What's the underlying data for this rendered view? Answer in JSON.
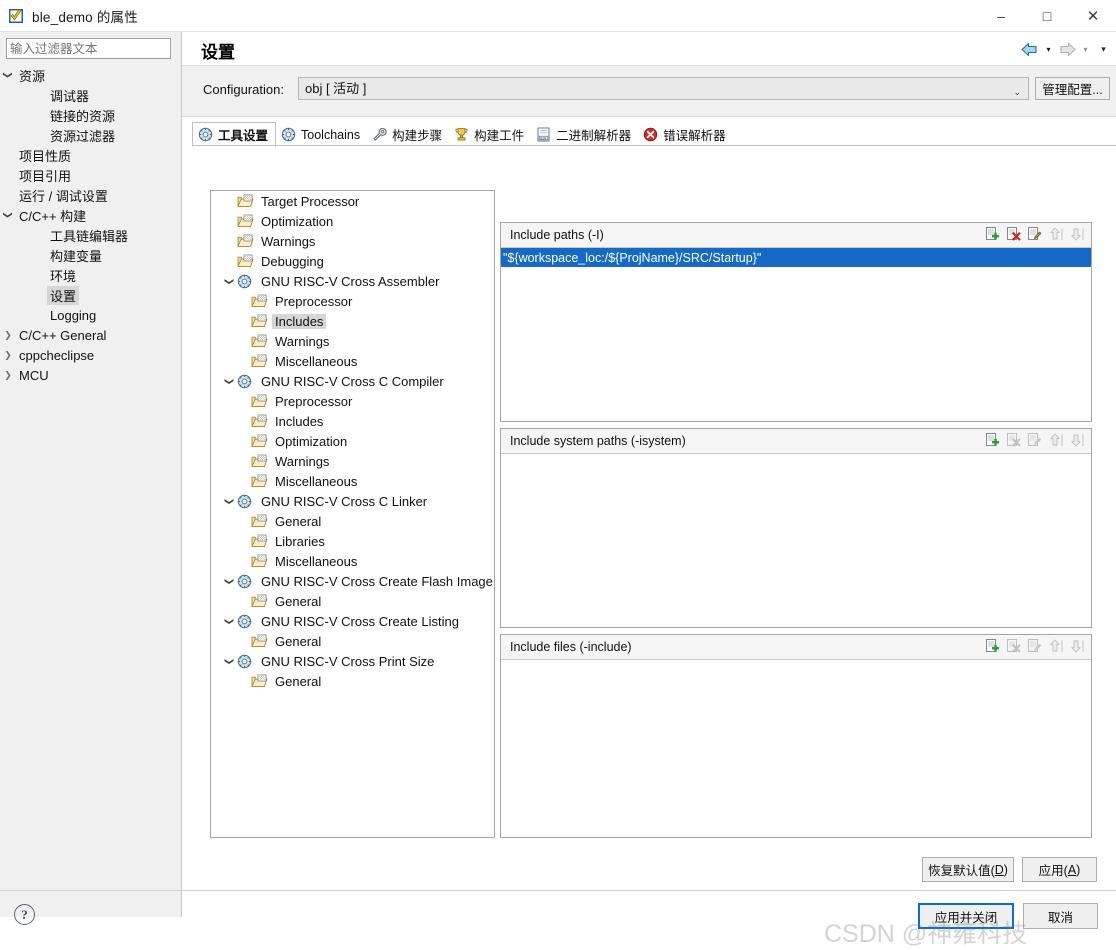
{
  "window": {
    "title": "ble_demo 的属性",
    "icon": "properties-icon",
    "minimize": "–",
    "maximize": "□",
    "close": "✕"
  },
  "sidebar": {
    "filter_placeholder": "输入过滤器文本",
    "filter_value": "",
    "items": [
      {
        "label": "资源",
        "level": 1,
        "twisty": "expanded"
      },
      {
        "label": "调试器",
        "level": 2,
        "twisty": "none"
      },
      {
        "label": "链接的资源",
        "level": 2,
        "twisty": "none"
      },
      {
        "label": "资源过滤器",
        "level": 2,
        "twisty": "none"
      },
      {
        "label": "项目性质",
        "level": 1,
        "twisty": "none"
      },
      {
        "label": "项目引用",
        "level": 1,
        "twisty": "none"
      },
      {
        "label": "运行 / 调试设置",
        "level": 1,
        "twisty": "none"
      },
      {
        "label": "C/C++ 构建",
        "level": 1,
        "twisty": "expanded"
      },
      {
        "label": "工具链编辑器",
        "level": 2,
        "twisty": "none"
      },
      {
        "label": "构建变量",
        "level": 2,
        "twisty": "none"
      },
      {
        "label": "环境",
        "level": 2,
        "twisty": "none"
      },
      {
        "label": "设置",
        "level": 2,
        "twisty": "none",
        "selected": true
      },
      {
        "label": "Logging",
        "level": 2,
        "twisty": "none"
      },
      {
        "label": "C/C++ General",
        "level": 1,
        "twisty": "collapsed"
      },
      {
        "label": "cppcheclipse",
        "level": 1,
        "twisty": "collapsed"
      },
      {
        "label": "MCU",
        "level": 1,
        "twisty": "collapsed"
      }
    ],
    "help_icon": "?"
  },
  "header": {
    "title": "设置",
    "nav_back_icon": "back-arrow-icon",
    "nav_back_chevron": "▾",
    "nav_forward_icon": "forward-arrow-icon",
    "nav_forward_chevron": "▾",
    "nav_menu_chevron": "▾"
  },
  "config": {
    "label": "Configuration:",
    "value": "obj [ 活动 ]",
    "dropdown_icon": "⌄",
    "manage_button": "管理配置..."
  },
  "tabs": [
    {
      "label": "工具设置",
      "icon": "gear-icon",
      "active": true
    },
    {
      "label": "Toolchains",
      "icon": "gear-icon",
      "active": false
    },
    {
      "label": "构建步骤",
      "icon": "wrench-icon",
      "active": false
    },
    {
      "label": "构建工件",
      "icon": "trophy-icon",
      "active": false
    },
    {
      "label": "二进制解析器",
      "icon": "binary-icon",
      "active": false
    },
    {
      "label": "错误解析器",
      "icon": "error-icon",
      "active": false
    }
  ],
  "tool_tree": [
    {
      "label": "Target Processor",
      "kind": "leaf",
      "indent": "top"
    },
    {
      "label": "Optimization",
      "kind": "leaf",
      "indent": "top"
    },
    {
      "label": "Warnings",
      "kind": "leaf",
      "indent": "top"
    },
    {
      "label": "Debugging",
      "kind": "leaf",
      "indent": "top"
    },
    {
      "label": "GNU RISC-V Cross Assembler",
      "kind": "group",
      "indent": "grp",
      "twisty": "expanded"
    },
    {
      "label": "Preprocessor",
      "kind": "leaf",
      "indent": "child"
    },
    {
      "label": "Includes",
      "kind": "leaf",
      "indent": "child",
      "selected": true
    },
    {
      "label": "Warnings",
      "kind": "leaf",
      "indent": "child"
    },
    {
      "label": "Miscellaneous",
      "kind": "leaf",
      "indent": "child"
    },
    {
      "label": "GNU RISC-V Cross C Compiler",
      "kind": "group",
      "indent": "grp",
      "twisty": "expanded"
    },
    {
      "label": "Preprocessor",
      "kind": "leaf",
      "indent": "child"
    },
    {
      "label": "Includes",
      "kind": "leaf",
      "indent": "child"
    },
    {
      "label": "Optimization",
      "kind": "leaf",
      "indent": "child"
    },
    {
      "label": "Warnings",
      "kind": "leaf",
      "indent": "child"
    },
    {
      "label": "Miscellaneous",
      "kind": "leaf",
      "indent": "child"
    },
    {
      "label": "GNU RISC-V Cross C Linker",
      "kind": "group",
      "indent": "grp",
      "twisty": "expanded"
    },
    {
      "label": "General",
      "kind": "leaf",
      "indent": "child"
    },
    {
      "label": "Libraries",
      "kind": "leaf",
      "indent": "child"
    },
    {
      "label": "Miscellaneous",
      "kind": "leaf",
      "indent": "child"
    },
    {
      "label": "GNU RISC-V Cross Create Flash Image",
      "kind": "group",
      "indent": "grp",
      "twisty": "expanded"
    },
    {
      "label": "General",
      "kind": "leaf",
      "indent": "child"
    },
    {
      "label": "GNU RISC-V Cross Create Listing",
      "kind": "group",
      "indent": "grp",
      "twisty": "expanded"
    },
    {
      "label": "General",
      "kind": "leaf",
      "indent": "child"
    },
    {
      "label": "GNU RISC-V Cross Print Size",
      "kind": "group",
      "indent": "grp",
      "twisty": "expanded"
    },
    {
      "label": "General",
      "kind": "leaf",
      "indent": "child"
    }
  ],
  "panels": {
    "include_paths": {
      "title": "Include paths (-I)",
      "items": [
        "\"${workspace_loc:/${ProjName}/SRC/Startup}\""
      ],
      "selected_index": 0,
      "tools": [
        {
          "name": "add-icon",
          "enabled": true
        },
        {
          "name": "delete-icon",
          "enabled": true
        },
        {
          "name": "edit-icon",
          "enabled": true
        },
        {
          "name": "move-up-icon",
          "enabled": false
        },
        {
          "name": "move-down-icon",
          "enabled": false
        }
      ]
    },
    "include_system_paths": {
      "title": "Include system paths (-isystem)",
      "items": [],
      "tools": [
        {
          "name": "add-icon",
          "enabled": true
        },
        {
          "name": "delete-icon",
          "enabled": false
        },
        {
          "name": "edit-icon",
          "enabled": false
        },
        {
          "name": "move-up-icon",
          "enabled": false
        },
        {
          "name": "move-down-icon",
          "enabled": false
        }
      ]
    },
    "include_files": {
      "title": "Include files (-include)",
      "items": [],
      "tools": [
        {
          "name": "add-icon",
          "enabled": true
        },
        {
          "name": "delete-icon",
          "enabled": false
        },
        {
          "name": "edit-icon",
          "enabled": false
        },
        {
          "name": "move-up-icon",
          "enabled": false
        },
        {
          "name": "move-down-icon",
          "enabled": false
        }
      ]
    }
  },
  "buttons": {
    "restore_defaults": "恢复默认值(D)",
    "apply": "应用(A)",
    "apply_and_close": "应用并关闭",
    "cancel": "取消"
  },
  "watermark": "CSDN @神雍科技"
}
